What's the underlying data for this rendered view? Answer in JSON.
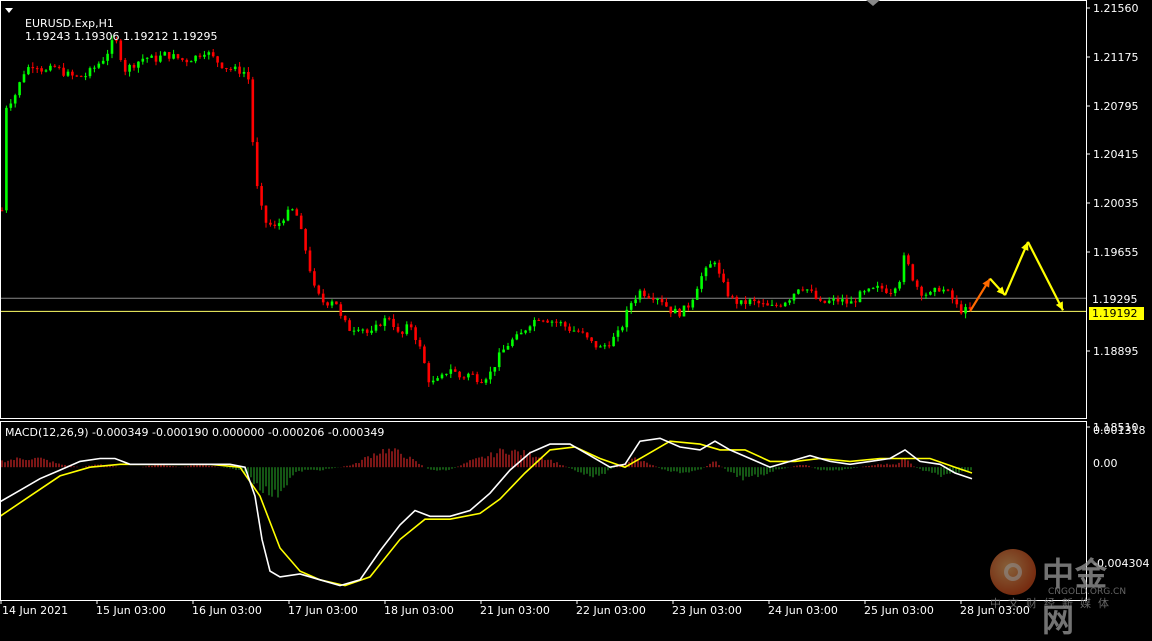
{
  "header": {
    "symbol": "EURUSD.Exp,H1",
    "ohlc": "1.19243 1.19306 1.19212 1.19295"
  },
  "price_axis": {
    "ticks": [
      "1.21560",
      "1.21175",
      "1.20795",
      "1.20415",
      "1.20035",
      "1.19655",
      "1.19295",
      "1.18895",
      "1.18510"
    ],
    "bid_tag": "1.19295",
    "mark_tag": "1.19192"
  },
  "macd": {
    "header": "MACD(12,26,9) -0.000349 -0.000190 0.000000 -0.000206 -0.000349",
    "ticks": [
      "0.001318",
      "0.00",
      "-0.004304"
    ]
  },
  "time_axis": {
    "ticks": [
      "14 Jun 2021",
      "15 Jun 03:00",
      "16 Jun 03:00",
      "17 Jun 03:00",
      "18 Jun 03:00",
      "21 Jun 03:00",
      "22 Jun 03:00",
      "23 Jun 03:00",
      "24 Jun 03:00",
      "25 Jun 03:00",
      "28 Jun 03:00"
    ]
  },
  "watermark": {
    "title": "中金网",
    "domain": "CNGOLD.ORG.CN",
    "slogan": "中文财经新媒体"
  },
  "colors": {
    "background": "#000000",
    "bull": "#00ff00",
    "bear": "#ff0000",
    "macd_main": "#ffffff",
    "macd_signal": "#ffff00",
    "hist_pos": "#b02020",
    "hist_neg": "#1d7a1d",
    "projection": "#ffff00"
  },
  "chart_data": {
    "type": "candlestick",
    "title": "EURUSD.Exp,H1",
    "ylim": [
      1.1835,
      1.2165
    ],
    "bid_line": 1.19295,
    "mark_line": 1.19192,
    "price_path": [
      [
        0,
        1.1945
      ],
      [
        5,
        1.208
      ],
      [
        15,
        1.209
      ],
      [
        25,
        1.211
      ],
      [
        35,
        1.2115
      ],
      [
        45,
        1.2108
      ],
      [
        55,
        1.2112
      ],
      [
        65,
        1.2107
      ],
      [
        75,
        1.2104
      ],
      [
        85,
        1.2105
      ],
      [
        95,
        1.2112
      ],
      [
        105,
        1.212
      ],
      [
        115,
        1.2135
      ],
      [
        125,
        1.211
      ],
      [
        135,
        1.2115
      ],
      [
        145,
        1.212
      ],
      [
        155,
        1.2118
      ],
      [
        165,
        1.2122
      ],
      [
        175,
        1.212
      ],
      [
        185,
        1.2117
      ],
      [
        195,
        1.212
      ],
      [
        205,
        1.2125
      ],
      [
        215,
        1.2118
      ],
      [
        225,
        1.2112
      ],
      [
        235,
        1.211
      ],
      [
        245,
        1.2108
      ],
      [
        250,
        1.21
      ],
      [
        253,
        1.205
      ],
      [
        258,
        1.201
      ],
      [
        265,
        1.199
      ],
      [
        275,
        1.1985
      ],
      [
        285,
        1.1995
      ],
      [
        295,
        1.2
      ],
      [
        305,
        1.197
      ],
      [
        315,
        1.1935
      ],
      [
        325,
        1.1925
      ],
      [
        335,
        1.193
      ],
      [
        340,
        1.1915
      ],
      [
        350,
        1.1905
      ],
      [
        360,
        1.1908
      ],
      [
        370,
        1.19
      ],
      [
        380,
        1.191
      ],
      [
        390,
        1.1915
      ],
      [
        400,
        1.1898
      ],
      [
        410,
        1.191
      ],
      [
        420,
        1.189
      ],
      [
        430,
        1.1862
      ],
      [
        440,
        1.1865
      ],
      [
        450,
        1.1875
      ],
      [
        460,
        1.1867
      ],
      [
        470,
        1.187
      ],
      [
        480,
        1.1865
      ],
      [
        490,
        1.187
      ],
      [
        500,
        1.1885
      ],
      [
        510,
        1.1895
      ],
      [
        520,
        1.19
      ],
      [
        530,
        1.191
      ],
      [
        540,
        1.1915
      ],
      [
        550,
        1.1912
      ],
      [
        560,
        1.191
      ],
      [
        570,
        1.1905
      ],
      [
        580,
        1.1903
      ],
      [
        590,
        1.1895
      ],
      [
        600,
        1.189
      ],
      [
        610,
        1.1895
      ],
      [
        620,
        1.1903
      ],
      [
        630,
        1.1925
      ],
      [
        640,
        1.1935
      ],
      [
        650,
        1.1932
      ],
      [
        660,
        1.193
      ],
      [
        670,
        1.192
      ],
      [
        680,
        1.1918
      ],
      [
        690,
        1.1925
      ],
      [
        700,
        1.1945
      ],
      [
        710,
        1.1955
      ],
      [
        715,
        1.196
      ],
      [
        720,
        1.1945
      ],
      [
        730,
        1.193
      ],
      [
        740,
        1.1925
      ],
      [
        750,
        1.1927
      ],
      [
        760,
        1.1925
      ],
      [
        770,
        1.1922
      ],
      [
        780,
        1.1925
      ],
      [
        790,
        1.193
      ],
      [
        800,
        1.194
      ],
      [
        810,
        1.1935
      ],
      [
        820,
        1.1925
      ],
      [
        830,
        1.1927
      ],
      [
        840,
        1.1928
      ],
      [
        850,
        1.1925
      ],
      [
        860,
        1.1932
      ],
      [
        870,
        1.1935
      ],
      [
        880,
        1.1938
      ],
      [
        890,
        1.1935
      ],
      [
        900,
        1.1945
      ],
      [
        905,
        1.1965
      ],
      [
        910,
        1.195
      ],
      [
        920,
        1.1935
      ],
      [
        930,
        1.1932
      ],
      [
        940,
        1.1938
      ],
      [
        950,
        1.1932
      ],
      [
        955,
        1.1925
      ],
      [
        960,
        1.192
      ],
      [
        970,
        1.192
      ]
    ],
    "projection": [
      [
        970,
        1.19192
      ],
      [
        990,
        1.1945
      ],
      [
        1005,
        1.1932
      ],
      [
        1028,
        1.1974
      ],
      [
        1063,
        1.192
      ]
    ],
    "macd_main": [
      [
        0,
        -0.0012
      ],
      [
        20,
        -0.0008
      ],
      [
        40,
        -0.0004
      ],
      [
        60,
        -0.0001
      ],
      [
        80,
        0.0002
      ],
      [
        100,
        0.0003
      ],
      [
        115,
        0.0003
      ],
      [
        130,
        0.0001
      ],
      [
        150,
        0.0001
      ],
      [
        170,
        0.0001
      ],
      [
        190,
        0.0001
      ],
      [
        210,
        0.0001
      ],
      [
        230,
        0.0001
      ],
      [
        245,
        0.0
      ],
      [
        255,
        -0.001
      ],
      [
        262,
        -0.0025
      ],
      [
        270,
        -0.0036
      ],
      [
        280,
        -0.0038
      ],
      [
        300,
        -0.0037
      ],
      [
        320,
        -0.0039
      ],
      [
        340,
        -0.0041
      ],
      [
        360,
        -0.0039
      ],
      [
        380,
        -0.0029
      ],
      [
        400,
        -0.002
      ],
      [
        415,
        -0.0015
      ],
      [
        430,
        -0.0017
      ],
      [
        450,
        -0.0017
      ],
      [
        470,
        -0.0015
      ],
      [
        490,
        -0.0009
      ],
      [
        510,
        -0.0001
      ],
      [
        530,
        0.0005
      ],
      [
        550,
        0.0008
      ],
      [
        570,
        0.0008
      ],
      [
        590,
        0.0004
      ],
      [
        610,
        0.0
      ],
      [
        625,
        0.0001
      ],
      [
        640,
        0.0009
      ],
      [
        660,
        0.001
      ],
      [
        680,
        0.0007
      ],
      [
        700,
        0.0006
      ],
      [
        715,
        0.0009
      ],
      [
        730,
        0.0006
      ],
      [
        750,
        0.0003
      ],
      [
        770,
        0.0
      ],
      [
        790,
        0.0002
      ],
      [
        810,
        0.0004
      ],
      [
        830,
        0.0002
      ],
      [
        850,
        0.0001
      ],
      [
        870,
        0.0002
      ],
      [
        890,
        0.0003
      ],
      [
        905,
        0.0006
      ],
      [
        920,
        0.0002
      ],
      [
        940,
        0.0001
      ],
      [
        955,
        -0.0002
      ],
      [
        972,
        -0.0004
      ]
    ],
    "macd_signal": [
      [
        0,
        -0.0017
      ],
      [
        30,
        -0.001
      ],
      [
        60,
        -0.0003
      ],
      [
        90,
        0.0
      ],
      [
        120,
        0.0001
      ],
      [
        150,
        0.0001
      ],
      [
        180,
        0.0001
      ],
      [
        210,
        0.0001
      ],
      [
        240,
        0.0
      ],
      [
        260,
        -0.001
      ],
      [
        280,
        -0.0028
      ],
      [
        300,
        -0.0036
      ],
      [
        320,
        -0.0039
      ],
      [
        345,
        -0.0041
      ],
      [
        370,
        -0.0038
      ],
      [
        400,
        -0.0025
      ],
      [
        425,
        -0.0018
      ],
      [
        450,
        -0.0018
      ],
      [
        480,
        -0.0016
      ],
      [
        500,
        -0.0011
      ],
      [
        525,
        -0.0002
      ],
      [
        550,
        0.0006
      ],
      [
        575,
        0.0007
      ],
      [
        600,
        0.0003
      ],
      [
        625,
        0.0
      ],
      [
        650,
        0.0005
      ],
      [
        670,
        0.0009
      ],
      [
        700,
        0.0008
      ],
      [
        720,
        0.0006
      ],
      [
        745,
        0.0006
      ],
      [
        770,
        0.0002
      ],
      [
        795,
        0.0002
      ],
      [
        820,
        0.0003
      ],
      [
        850,
        0.0002
      ],
      [
        880,
        0.0003
      ],
      [
        905,
        0.0003
      ],
      [
        930,
        0.0003
      ],
      [
        955,
        0.0
      ],
      [
        972,
        -0.0002
      ]
    ],
    "macd_hist": [
      [
        0,
        0.0002
      ],
      [
        20,
        0.0003
      ],
      [
        40,
        0.0003
      ],
      [
        60,
        0.0001
      ],
      [
        80,
        0.0
      ],
      [
        100,
        0.0001
      ],
      [
        120,
        0.0
      ],
      [
        140,
        0.0
      ],
      [
        160,
        0.0001
      ],
      [
        180,
        0.0
      ],
      [
        200,
        0.0001
      ],
      [
        220,
        0.0
      ],
      [
        240,
        -0.0001
      ],
      [
        255,
        -0.0005
      ],
      [
        265,
        -0.0008
      ],
      [
        275,
        -0.001
      ],
      [
        285,
        -0.0006
      ],
      [
        295,
        -0.0002
      ],
      [
        305,
        -0.0001
      ],
      [
        320,
        -0.0001
      ],
      [
        340,
        0.0
      ],
      [
        355,
        0.0001
      ],
      [
        370,
        0.0004
      ],
      [
        385,
        0.0006
      ],
      [
        400,
        0.0005
      ],
      [
        415,
        0.0002
      ],
      [
        430,
        -0.0001
      ],
      [
        450,
        -0.0001
      ],
      [
        470,
        0.0002
      ],
      [
        490,
        0.0004
      ],
      [
        505,
        0.0006
      ],
      [
        520,
        0.0005
      ],
      [
        540,
        0.0004
      ],
      [
        560,
        0.0001
      ],
      [
        575,
        -0.0001
      ],
      [
        590,
        -0.0003
      ],
      [
        605,
        -0.0002
      ],
      [
        620,
        0.0001
      ],
      [
        635,
        0.0003
      ],
      [
        650,
        0.0001
      ],
      [
        665,
        -0.0001
      ],
      [
        680,
        -0.0002
      ],
      [
        700,
        -0.0001
      ],
      [
        715,
        0.0002
      ],
      [
        730,
        -0.0002
      ],
      [
        745,
        -0.0004
      ],
      [
        760,
        -0.0003
      ],
      [
        775,
        -0.0001
      ],
      [
        790,
        0.0
      ],
      [
        805,
        0.0001
      ],
      [
        820,
        -0.0001
      ],
      [
        840,
        -0.0001
      ],
      [
        860,
        0.0
      ],
      [
        880,
        0.0001
      ],
      [
        895,
        0.0001
      ],
      [
        905,
        0.0003
      ],
      [
        915,
        0.0
      ],
      [
        930,
        -0.0002
      ],
      [
        945,
        -0.0003
      ],
      [
        960,
        -0.0002
      ],
      [
        972,
        -0.0001
      ]
    ],
    "macd_ylim": [
      -0.0046,
      0.0016
    ]
  }
}
